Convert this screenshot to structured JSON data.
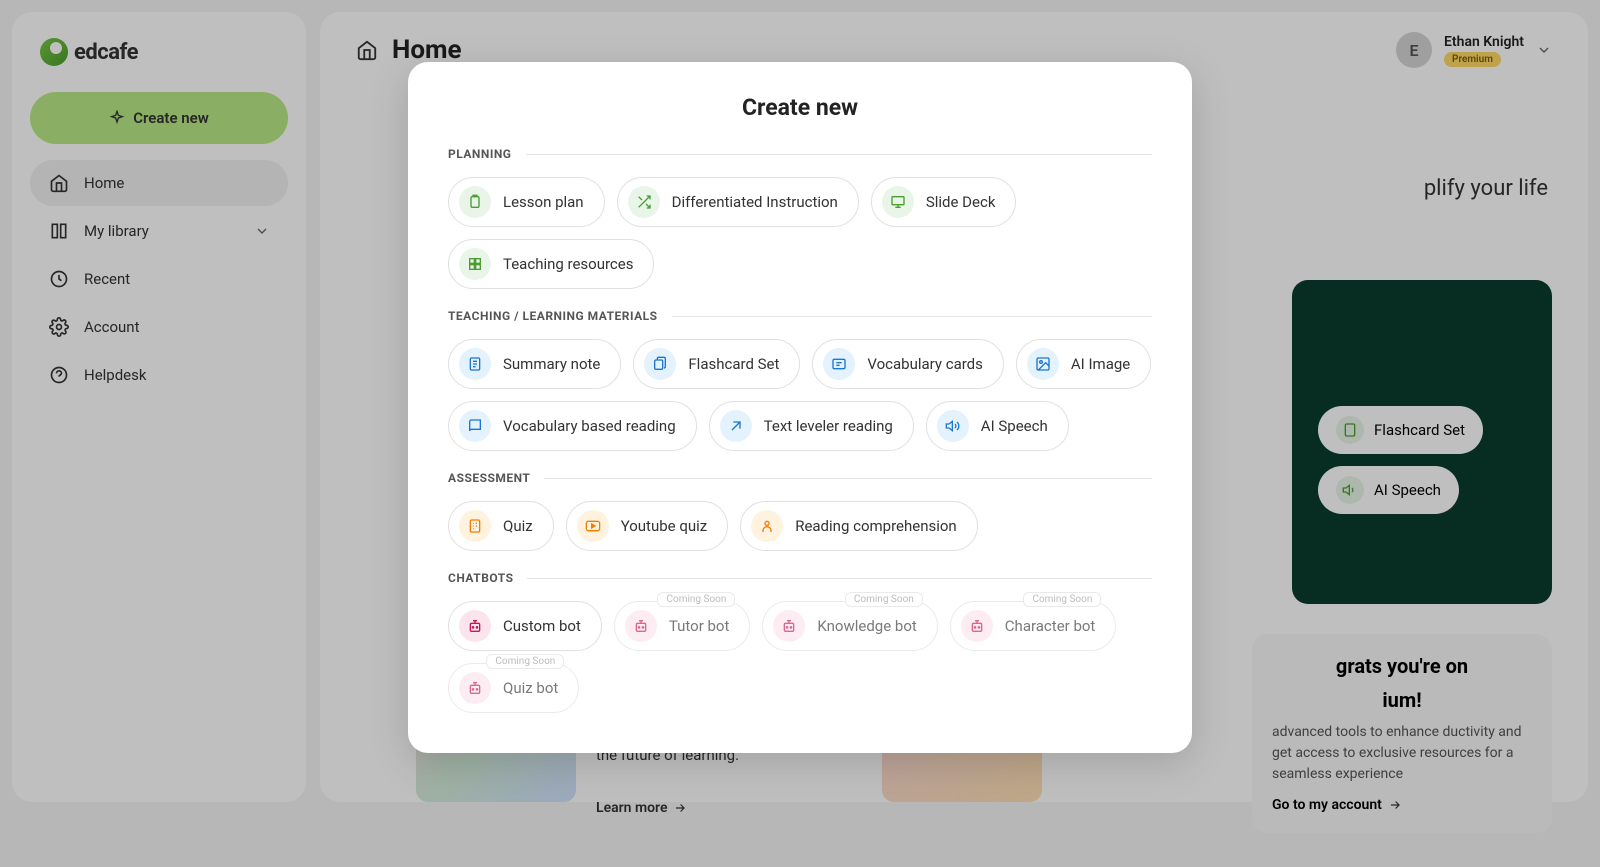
{
  "brand": "edcafe",
  "sidebar": {
    "createLabel": "Create new",
    "items": [
      {
        "label": "Home",
        "icon": "home",
        "active": true
      },
      {
        "label": "My library",
        "icon": "library",
        "expandable": true
      },
      {
        "label": "Recent",
        "icon": "clock"
      },
      {
        "label": "Account",
        "icon": "gear"
      },
      {
        "label": "Helpdesk",
        "icon": "help"
      }
    ]
  },
  "header": {
    "title": "Home",
    "user": {
      "initial": "E",
      "name": "Ethan Knight",
      "badge": "Premium"
    }
  },
  "background": {
    "heroTextPartial": "plify your life",
    "quickPills": [
      {
        "label": "Flashcard Set"
      },
      {
        "label": "AI Speech"
      }
    ],
    "contentSnippet": "the future of learning.",
    "learnMore": "Learn more",
    "promo": {
      "titlePartial1": "grats you're on",
      "titlePartial2": "ium!",
      "body": "advanced tools to enhance ductivity and get access to exclusive resources for a seamless experience",
      "cta": "Go to my account"
    }
  },
  "modal": {
    "title": "Create new",
    "sections": [
      {
        "label": "PLANNING",
        "colorClass": "green",
        "options": [
          {
            "label": "Lesson plan",
            "icon": "clipboard"
          },
          {
            "label": "Differentiated Instruction",
            "icon": "shuffle"
          },
          {
            "label": "Slide Deck",
            "icon": "presentation"
          },
          {
            "label": "Teaching resources",
            "icon": "resources"
          }
        ]
      },
      {
        "label": "TEACHING / LEARNING MATERIALS",
        "colorClass": "blue",
        "options": [
          {
            "label": "Summary note",
            "icon": "note"
          },
          {
            "label": "Flashcard Set",
            "icon": "cards"
          },
          {
            "label": "Vocabulary cards",
            "icon": "vocab"
          },
          {
            "label": "AI Image",
            "icon": "image"
          },
          {
            "label": "Vocabulary based reading",
            "icon": "book"
          },
          {
            "label": "Text leveler reading",
            "icon": "level"
          },
          {
            "label": "AI Speech",
            "icon": "speech"
          }
        ]
      },
      {
        "label": "ASSESSMENT",
        "colorClass": "orange",
        "options": [
          {
            "label": "Quiz",
            "icon": "quiz"
          },
          {
            "label": "Youtube quiz",
            "icon": "youtube"
          },
          {
            "label": "Reading comprehension",
            "icon": "reading"
          }
        ]
      },
      {
        "label": "CHATBOTS",
        "colorClass": "pink",
        "options": [
          {
            "label": "Custom bot",
            "icon": "bot"
          },
          {
            "label": "Tutor bot",
            "icon": "bot",
            "comingSoon": true
          },
          {
            "label": "Knowledge bot",
            "icon": "bot",
            "comingSoon": true
          },
          {
            "label": "Character bot",
            "icon": "bot",
            "comingSoon": true
          },
          {
            "label": "Quiz bot",
            "icon": "bot",
            "comingSoon": true
          }
        ]
      }
    ],
    "comingSoonLabel": "Coming Soon"
  }
}
